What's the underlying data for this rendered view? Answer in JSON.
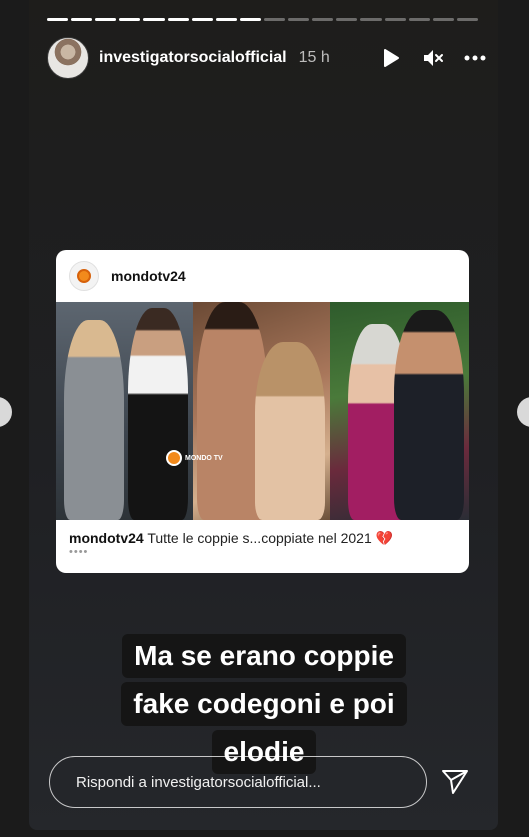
{
  "story": {
    "username": "investigatorsocialofficial",
    "time": "15 h",
    "progress_total": 18,
    "progress_done": 9
  },
  "icons": {
    "play": "play-icon",
    "mute": "speaker-muted-icon",
    "more": "more-horizontal-icon",
    "send": "send-icon",
    "prev": "chevron-left-icon",
    "next": "chevron-right-icon"
  },
  "post": {
    "username": "mondotv24",
    "caption_user": "mondotv24",
    "caption_text": "Tutte le coppie s...coppiate nel 2021 💔",
    "more_dots": "••••",
    "watermark": "MONDO TV"
  },
  "overlay_text": {
    "lines": [
      "Ma se erano coppie",
      "fake codegoni e poi",
      "elodie"
    ]
  },
  "reply": {
    "placeholder": "Rispondi a investigatorsocialofficial..."
  },
  "colors": {
    "background": "#1b1b1b",
    "accent_orange": "#f28a1c"
  }
}
